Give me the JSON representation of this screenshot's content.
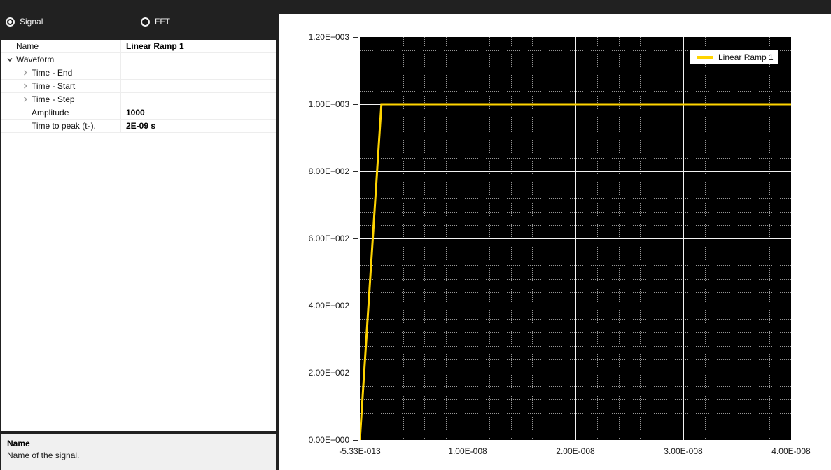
{
  "header": {
    "options": [
      {
        "label": "Signal",
        "selected": true
      },
      {
        "label": "FFT",
        "selected": false
      }
    ]
  },
  "property_grid": {
    "rows": [
      {
        "label": "Name",
        "value": "Linear Ramp 1",
        "level": 0,
        "expander": "none"
      },
      {
        "label": "Waveform",
        "value": "",
        "level": 0,
        "expander": "expanded"
      },
      {
        "label": "Time - End",
        "value": "",
        "level": 1,
        "expander": "collapsed"
      },
      {
        "label": "Time - Start",
        "value": "",
        "level": 1,
        "expander": "collapsed"
      },
      {
        "label": "Time - Step",
        "value": "",
        "level": 1,
        "expander": "collapsed"
      },
      {
        "label": "Amplitude",
        "value": "1000",
        "level": 1,
        "expander": "none"
      },
      {
        "label": "Time to peak (t₀).",
        "value": "2E-09 s",
        "level": 1,
        "expander": "none"
      }
    ]
  },
  "description": {
    "title": "Name",
    "body": "Name of the signal."
  },
  "chart_data": {
    "type": "line",
    "title": "",
    "xlabel": "",
    "ylabel": "",
    "xlim": [
      -5.33e-13,
      4e-08
    ],
    "ylim": [
      0,
      1200
    ],
    "x_ticks": {
      "values": [
        -5.33e-13,
        1e-08,
        2e-08,
        3e-08,
        4e-08
      ],
      "labels": [
        "-5.33E-013",
        "1.00E-008",
        "2.00E-008",
        "3.00E-008",
        "4.00E-008"
      ]
    },
    "y_ticks": {
      "values": [
        0,
        200,
        400,
        600,
        800,
        1000,
        1200
      ],
      "labels": [
        "0.00E+000",
        "2.00E+002",
        "4.00E+002",
        "6.00E+002",
        "8.00E+002",
        "1.00E+003",
        "1.20E+003"
      ]
    },
    "minor_divisions": 5,
    "grid": "major-solid-minor-dotted",
    "legend_position": "top-right",
    "series": [
      {
        "name": "Linear Ramp 1",
        "color": "#ffd400",
        "points": [
          [
            -5.33e-13,
            0
          ],
          [
            2e-09,
            1000
          ],
          [
            4e-08,
            1000
          ]
        ]
      }
    ]
  },
  "colors": {
    "panel_dark": "#212121",
    "plot_background": "#000000",
    "major_grid": "#f2f2f2",
    "minor_grid": "#999999",
    "accent_line": "#ffd400"
  }
}
